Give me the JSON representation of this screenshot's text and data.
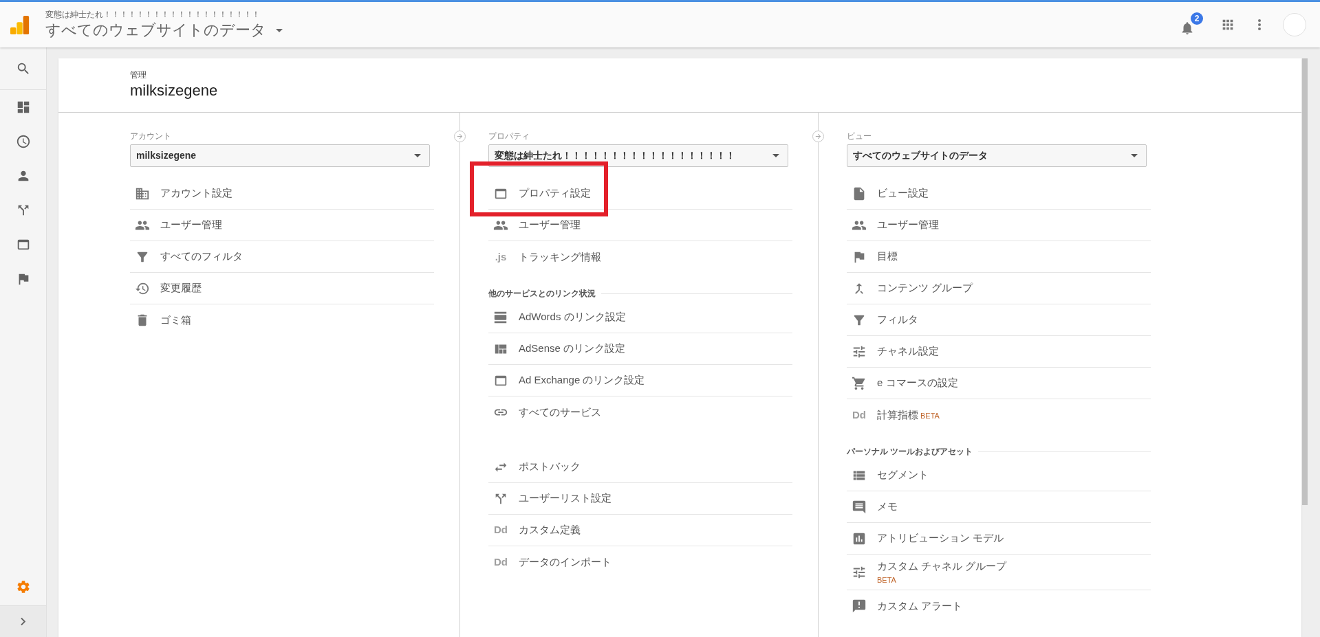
{
  "header": {
    "property_name": "変態は紳士たれ！！！！！！！！！！！！！！！！！！！",
    "view_name": "すべてのウェブサイトのデータ",
    "notification_count": "2"
  },
  "sidebar": {
    "items": [
      {
        "kind": "search",
        "selected": false
      },
      {
        "kind": "dashboard",
        "selected": false
      },
      {
        "kind": "clock",
        "selected": false
      },
      {
        "kind": "person",
        "selected": false
      },
      {
        "kind": "branch",
        "selected": false
      },
      {
        "kind": "window",
        "selected": false
      },
      {
        "kind": "flag",
        "selected": false
      }
    ],
    "admin": {
      "selected": true
    }
  },
  "admin": {
    "label": "管理",
    "account_name": "milksizegene"
  },
  "columns": [
    {
      "label": "アカウント",
      "connector": false,
      "selected_value": "milksizegene",
      "sections": [
        {
          "items": [
            {
              "kind": "building",
              "label": "アカウント設定"
            },
            {
              "kind": "people",
              "label": "ユーザー管理"
            },
            {
              "kind": "funnel",
              "label": "すべてのフィルタ"
            },
            {
              "kind": "history",
              "label": "変更履歴"
            },
            {
              "kind": "trash",
              "label": "ゴミ箱"
            }
          ]
        }
      ]
    },
    {
      "label": "プロパティ",
      "connector": true,
      "selected_value": "変態は紳士たれ！！！！！！！！！！！！！！！！！！",
      "sections": [
        {
          "items": [
            {
              "kind": "window",
              "label": "プロパティ設定",
              "highlighted": true
            },
            {
              "kind": "people",
              "label": "ユーザー管理"
            },
            {
              "icon_text": ".js",
              "label": "トラッキング情報"
            }
          ]
        },
        {
          "heading": "他のサービスとのリンク状況",
          "items": [
            {
              "kind": "headline",
              "label": "AdWords のリンク設定"
            },
            {
              "kind": "quilt",
              "label": "AdSense のリンク設定"
            },
            {
              "kind": "window",
              "label": "Ad Exchange のリンク設定"
            },
            {
              "kind": "link",
              "label": "すべてのサービス"
            }
          ]
        },
        {
          "items": [
            {
              "kind": "swap",
              "label": "ポストバック"
            },
            {
              "kind": "split",
              "label": "ユーザーリスト設定"
            },
            {
              "icon_text": "Dd",
              "label": "カスタム定義"
            },
            {
              "icon_text": "Dd",
              "label": "データのインポート"
            }
          ]
        }
      ]
    },
    {
      "label": "ビュー",
      "connector": true,
      "selected_value": "すべてのウェブサイトのデータ",
      "sections": [
        {
          "items": [
            {
              "kind": "file",
              "label": "ビュー設定"
            },
            {
              "kind": "people",
              "label": "ユーザー管理"
            },
            {
              "kind": "flag",
              "label": "目標"
            },
            {
              "kind": "merge",
              "label": "コンテンツ グループ"
            },
            {
              "kind": "funnel",
              "label": "フィルタ"
            },
            {
              "kind": "tune",
              "label": "チャネル設定"
            },
            {
              "kind": "cart",
              "label": "e コマースの設定"
            },
            {
              "icon_text": "Dd",
              "label": "計算指標",
              "badge": "BETA",
              "badge_below": false
            }
          ]
        },
        {
          "heading": "パーソナル ツールおよびアセット",
          "items": [
            {
              "kind": "list",
              "label": "セグメント"
            },
            {
              "kind": "comment",
              "label": "メモ"
            },
            {
              "kind": "chart",
              "label": "アトリビューション モデル"
            },
            {
              "kind": "tune",
              "label": "カスタム チャネル グループ",
              "badge": "BETA",
              "badge_below": true
            },
            {
              "kind": "megaphone",
              "label": "カスタム アラート"
            }
          ]
        }
      ]
    }
  ]
}
